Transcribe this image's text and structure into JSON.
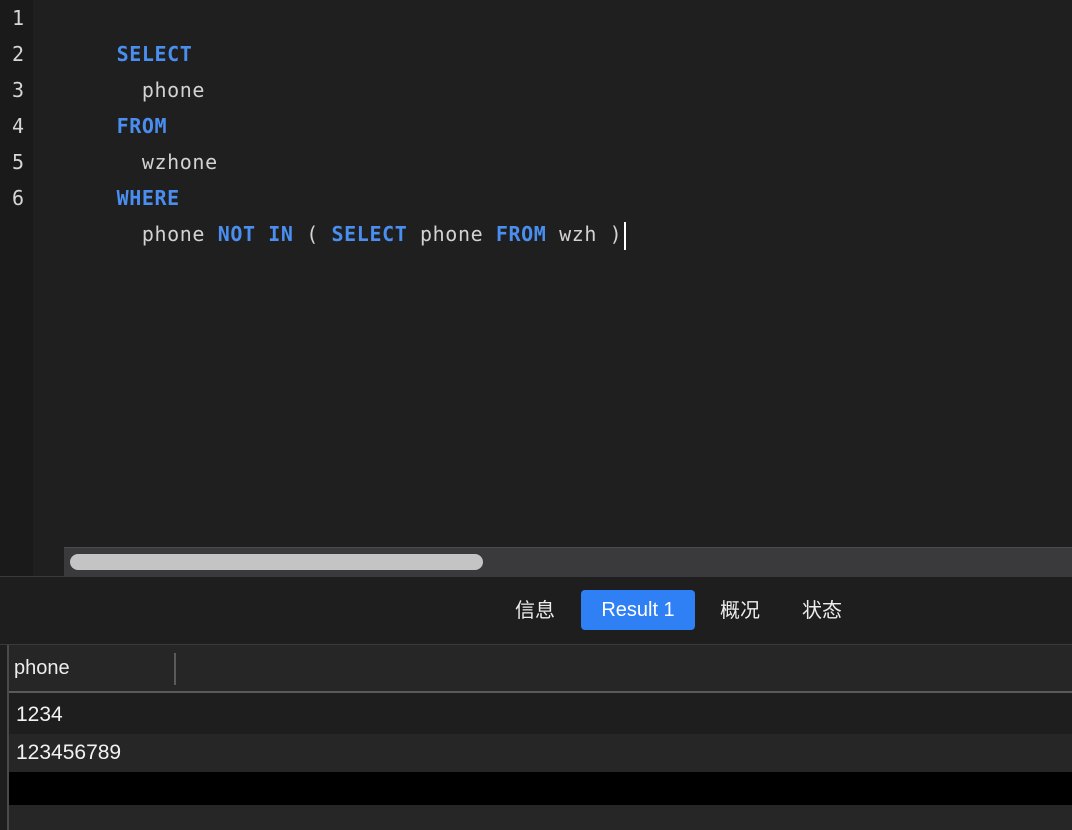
{
  "editor": {
    "line_numbers": [
      "1",
      "2",
      "3",
      "4",
      "5",
      "6"
    ],
    "lines": [
      [
        {
          "t": "SELECT",
          "k": true
        }
      ],
      [
        {
          "t": "  phone",
          "k": false
        }
      ],
      [
        {
          "t": "FROM",
          "k": true
        }
      ],
      [
        {
          "t": "  wzhone",
          "k": false
        }
      ],
      [
        {
          "t": "WHERE",
          "k": true
        }
      ],
      [
        {
          "t": "  phone ",
          "k": false
        },
        {
          "t": "NOT IN",
          "k": true
        },
        {
          "t": " ( ",
          "k": false
        },
        {
          "t": "SELECT",
          "k": true
        },
        {
          "t": " phone ",
          "k": false
        },
        {
          "t": "FROM",
          "k": true
        },
        {
          "t": " wzh )",
          "k": false
        }
      ]
    ]
  },
  "tabs": {
    "info": "信息",
    "result": "Result 1",
    "overview": "概况",
    "status": "状态"
  },
  "grid": {
    "column": "phone",
    "rows": [
      "1234",
      "123456789"
    ]
  },
  "colors": {
    "keyword": "#4a8ef0",
    "active_tab": "#2f7ff5"
  }
}
